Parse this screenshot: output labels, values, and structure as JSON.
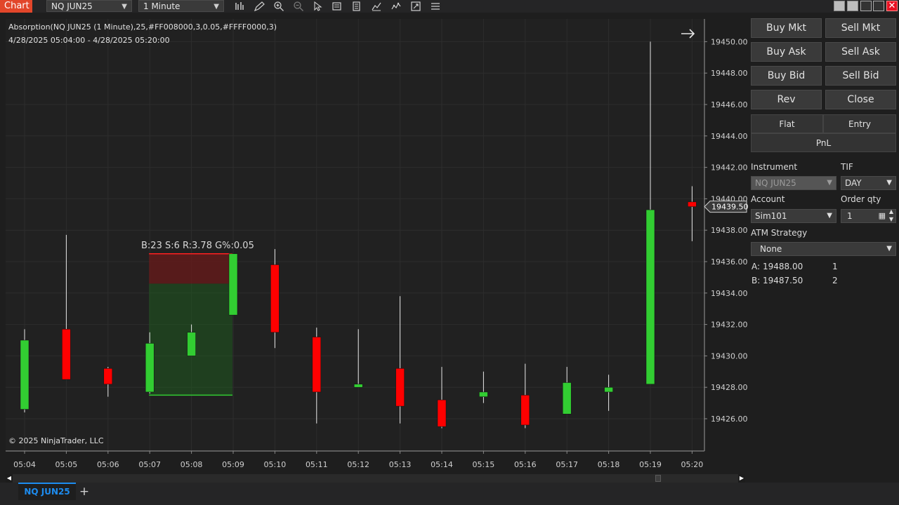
{
  "toolbar": {
    "app_title": "Chart",
    "instrument": "NQ JUN25",
    "interval": "1 Minute",
    "icons": [
      "bars-icon",
      "pencil-icon",
      "zoom-in-icon",
      "zoom-out-icon",
      "pointer-icon",
      "data-box-icon",
      "properties-icon",
      "indicators-icon",
      "strategies-icon",
      "share-icon",
      "menu-icon"
    ]
  },
  "chart": {
    "indicator_label": "Absorption(NQ JUN25 (1 Minute),25,#FF008000,3,0.05,#FFFF0000,3)",
    "date_range": "4/28/2025 05:04:00 - 4/28/2025 05:20:00",
    "copyright": "© 2025 NinjaTrader, LLC",
    "absorption_label": "B:23 S:6 R:3.78 G%:0.05",
    "current_price_label": "19439.50",
    "up_color": "#32cd32",
    "down_color": "#ff0000"
  },
  "chart_data": {
    "type": "candlestick",
    "instrument": "NQ JUN25",
    "interval": "1 Minute",
    "x": [
      "05:04",
      "05:05",
      "05:06",
      "05:07",
      "05:08",
      "05:09",
      "05:10",
      "05:11",
      "05:12",
      "05:13",
      "05:14",
      "05:15",
      "05:16",
      "05:17",
      "05:18",
      "05:19",
      "05:20"
    ],
    "open": [
      19426.6,
      19431.7,
      19429.2,
      19427.7,
      19430.0,
      19432.6,
      19435.8,
      19431.2,
      19428.0,
      19429.2,
      19427.2,
      19427.4,
      19427.5,
      19426.3,
      19427.7,
      19428.2,
      19439.8
    ],
    "high": [
      19431.7,
      19437.7,
      19429.3,
      19431.5,
      19432.0,
      19436.5,
      19436.8,
      19431.8,
      19431.7,
      19433.8,
      19429.3,
      19429.0,
      19429.5,
      19429.3,
      19428.8,
      19450.0,
      19440.8
    ],
    "low": [
      19426.4,
      19428.5,
      19427.4,
      19427.6,
      19430.0,
      19432.6,
      19430.5,
      19425.7,
      19428.0,
      19425.7,
      19425.4,
      19427.0,
      19425.4,
      19426.3,
      19426.5,
      19428.2,
      19437.3
    ],
    "close": [
      19431.0,
      19428.5,
      19428.2,
      19430.8,
      19431.5,
      19436.5,
      19431.5,
      19427.7,
      19428.2,
      19426.8,
      19425.5,
      19427.7,
      19425.6,
      19428.3,
      19428.0,
      19439.3,
      19439.5
    ],
    "yticks": [
      "19426.00",
      "19428.00",
      "19430.00",
      "19432.00",
      "19434.00",
      "19436.00",
      "19438.00",
      "19440.00",
      "19442.00",
      "19444.00",
      "19446.00",
      "19448.00",
      "19450.00"
    ],
    "ylim": [
      19424.5,
      19451.0
    ],
    "absorption_zone": {
      "x_start": "05:07",
      "x_end": "05:09",
      "high": 19436.5,
      "low": 19427.5,
      "red_band_low": 19434.6,
      "label": "B:23 S:6 R:3.78 G%:0.05"
    },
    "current_price": 19439.5,
    "grid": true
  },
  "panel": {
    "buttons": [
      "Buy Mkt",
      "Sell Mkt",
      "Buy Ask",
      "Sell Ask",
      "Buy Bid",
      "Sell Bid",
      "Rev",
      "Close"
    ],
    "flat": "Flat",
    "entry": "Entry",
    "pnl": "PnL",
    "instrument_label": "Instrument",
    "instrument_value": "NQ JUN25",
    "tif_label": "TIF",
    "tif_value": "DAY",
    "account_label": "Account",
    "account_value": "Sim101",
    "qty_label": "Order qty",
    "qty_value": "1",
    "atm_label": "ATM Strategy",
    "atm_value": "None",
    "ask_label": "A:",
    "ask_price": "19488.00",
    "ask_qty": "1",
    "bid_label": "B:",
    "bid_price": "19487.50",
    "bid_qty": "2"
  },
  "tabs": {
    "main": "NQ JUN25",
    "add": "+"
  }
}
